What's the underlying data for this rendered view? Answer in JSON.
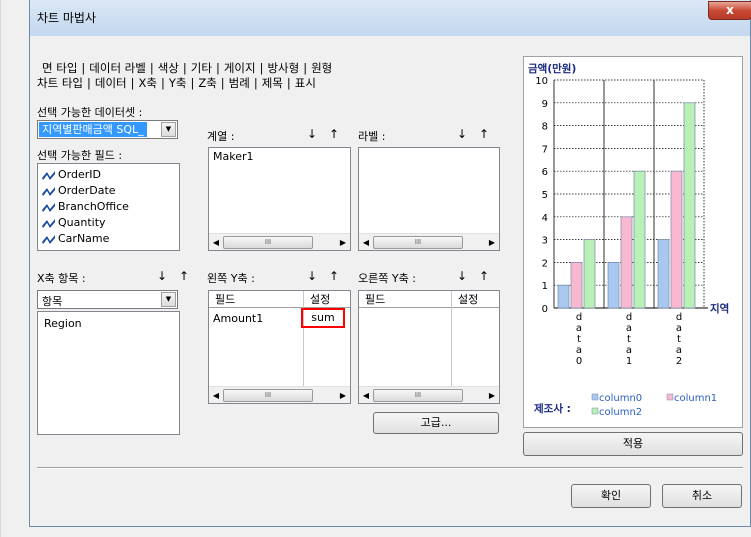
{
  "window": {
    "title": "차트 마법사",
    "close_glyph": "x"
  },
  "tabs": {
    "row1": [
      "면 타입",
      "데이터 라벨",
      "색상",
      "기타",
      "게이지",
      "방사형",
      "원형"
    ],
    "row2": [
      "차트 타입",
      "데이터",
      "X축",
      "Y축",
      "Z축",
      "범례",
      "제목",
      "표시"
    ],
    "active": "데이터"
  },
  "dataset": {
    "label": "선택 가능한 데이터셋 :",
    "selected": "지역별판매금액 SQL_"
  },
  "fields": {
    "label": "선택 가능한 필드 :",
    "items": [
      "OrderID",
      "OrderDate",
      "BranchOffice",
      "Quantity",
      "CarName"
    ]
  },
  "series": {
    "label": "계열 :",
    "items": [
      "Maker1"
    ]
  },
  "labels_panel": {
    "label": "라벨 :"
  },
  "x_items": {
    "label": "X축 항목 :",
    "combo_value": "항목",
    "items": [
      "Region"
    ]
  },
  "left_y": {
    "label": "왼쪽 Y축 :",
    "col_field": "필드",
    "col_setting": "설정",
    "rows": [
      {
        "field": "Amount1",
        "setting": "sum"
      }
    ]
  },
  "right_y": {
    "label": "오른쪽 Y축 :",
    "col_field": "필드",
    "col_setting": "설정"
  },
  "buttons": {
    "up": "↑",
    "down": "↓",
    "advanced": "고급...",
    "apply": "적용",
    "ok": "확인",
    "cancel": "취소"
  },
  "highlight_color": "#ff0000",
  "chart_data": {
    "type": "bar",
    "ylabel": "금액(만원)",
    "xlabel": "지역",
    "ylim": [
      0,
      10
    ],
    "yticks": [
      "0",
      "1",
      "2",
      "3",
      "4",
      "5",
      "6",
      "7",
      "8",
      "9",
      "10"
    ],
    "categories": [
      "data0",
      "data1",
      "data2"
    ],
    "series": [
      {
        "name": "column0",
        "color": "#a8c8f0",
        "values": [
          1,
          2,
          3
        ]
      },
      {
        "name": "column1",
        "color": "#f8b8d0",
        "values": [
          2,
          4,
          6
        ]
      },
      {
        "name": "column2",
        "color": "#b8f0b8",
        "values": [
          3,
          6,
          9
        ]
      }
    ],
    "legend_title": "제조사 :",
    "legend_position": "bottom",
    "grid": true
  }
}
